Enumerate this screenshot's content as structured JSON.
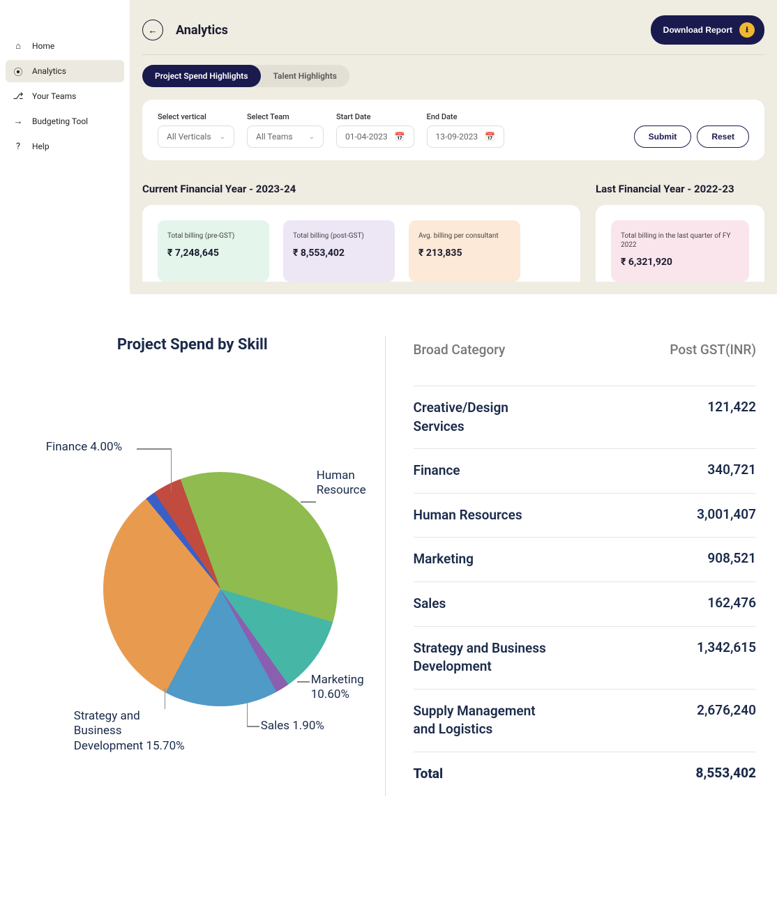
{
  "sidebar": {
    "items": [
      {
        "label": "Home",
        "icon": "home-icon",
        "glyph": "⌂"
      },
      {
        "label": "Analytics",
        "icon": "analytics-icon",
        "glyph": "⦿",
        "active": true
      },
      {
        "label": "Your Teams",
        "icon": "teams-icon",
        "glyph": "⎇"
      },
      {
        "label": "Budgeting Tool",
        "icon": "budgeting-icon",
        "glyph": "→"
      },
      {
        "label": "Help",
        "icon": "help-icon",
        "glyph": "?"
      }
    ]
  },
  "header": {
    "title": "Analytics",
    "download_label": "Download Report"
  },
  "tabs": {
    "items": [
      {
        "label": "Project Spend Highlights",
        "active": true
      },
      {
        "label": "Talent Highlights",
        "active": false
      }
    ]
  },
  "filters": {
    "vertical_label": "Select vertical",
    "vertical_value": "All Verticals",
    "team_label": "Select Team",
    "team_value": "All Teams",
    "start_label": "Start Date",
    "start_value": "01-04-2023",
    "end_label": "End Date",
    "end_value": "13-09-2023",
    "submit_label": "Submit",
    "reset_label": "Reset"
  },
  "fy_current": {
    "title": "Current Financial Year - 2023-24",
    "cards": [
      {
        "label": "Total billing (pre-GST)",
        "value": "₹ 7,248,645",
        "color": "c-green"
      },
      {
        "label": "Total billing (post-GST)",
        "value": "₹ 8,553,402",
        "color": "c-purple"
      },
      {
        "label": "Avg. billing per consultant",
        "value": "₹ 213,835",
        "color": "c-orange"
      }
    ]
  },
  "fy_last": {
    "title": "Last Financial Year - 2022-23",
    "cards": [
      {
        "label": "Total billing in the last quarter of FY 2022",
        "value": "₹ 6,321,920",
        "color": "c-pink"
      }
    ]
  },
  "chart_title": "Project Spend by Skill",
  "chart_data": {
    "type": "pie",
    "title": "Project Spend by Skill",
    "series": [
      {
        "name": "Human Resource",
        "percent": 35.1,
        "color": "#8fbb4f"
      },
      {
        "name": "Marketing",
        "percent": 10.6,
        "color": "#46b6a6"
      },
      {
        "name": "Sales",
        "percent": 1.9,
        "color": "#8b5fb0"
      },
      {
        "name": "Strategy and Business Development",
        "percent": 15.7,
        "color": "#4f9ac7"
      },
      {
        "name": "Supply Management and Logistics",
        "percent": 31.3,
        "color": "#e89b4e"
      },
      {
        "name": "Creative/Design Services",
        "percent": 1.4,
        "color": "#3a5fc8"
      },
      {
        "name": "Finance",
        "percent": 4.0,
        "color": "#c14b3e"
      }
    ],
    "labels_shown": [
      {
        "text": "Finance 4.00%"
      },
      {
        "text": "Human Resource"
      },
      {
        "text": "Marketing 10.60%"
      },
      {
        "text": "Sales 1.90%"
      },
      {
        "text": "Strategy and Business Development 15.70%"
      }
    ]
  },
  "table": {
    "head_category": "Broad Category",
    "head_value": "Post GST(INR)",
    "rows": [
      {
        "category": "Creative/Design Services",
        "value": "121,422"
      },
      {
        "category": "Finance",
        "value": "340,721"
      },
      {
        "category": "Human Resources",
        "value": "3,001,407"
      },
      {
        "category": "Marketing",
        "value": "908,521"
      },
      {
        "category": "Sales",
        "value": "162,476"
      },
      {
        "category": "Strategy and Business Development",
        "value": "1,342,615"
      },
      {
        "category": "Supply Management and Logistics",
        "value": "2,676,240"
      }
    ],
    "total_label": "Total",
    "total_value": "8,553,402"
  }
}
